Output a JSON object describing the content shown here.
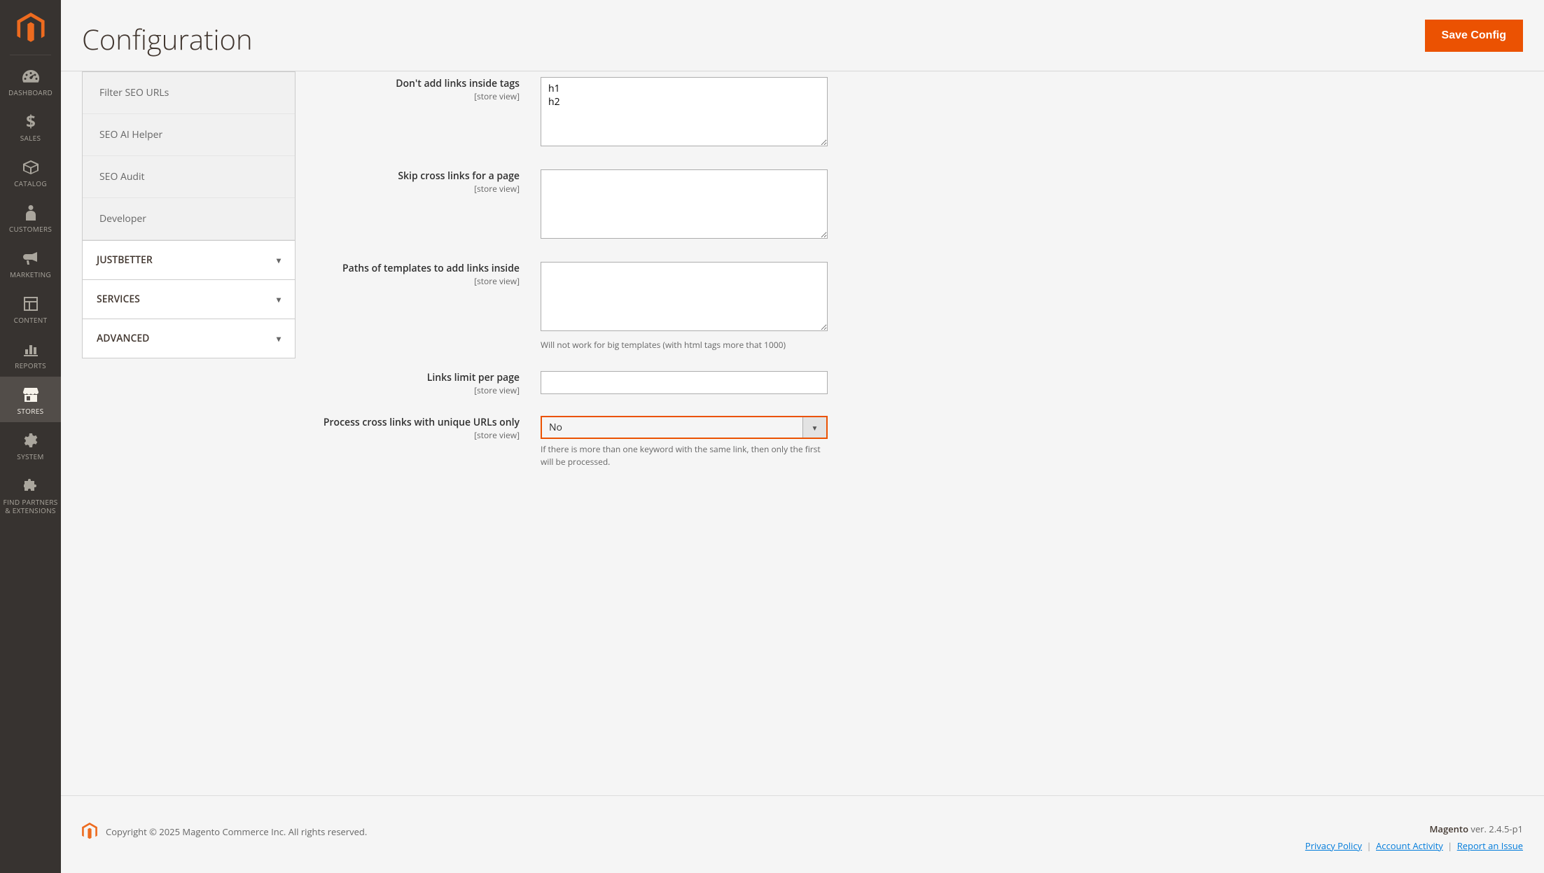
{
  "page": {
    "title": "Configuration"
  },
  "actions": {
    "save": "Save Config"
  },
  "sidebar": {
    "items": [
      {
        "label": "DASHBOARD"
      },
      {
        "label": "SALES"
      },
      {
        "label": "CATALOG"
      },
      {
        "label": "CUSTOMERS"
      },
      {
        "label": "MARKETING"
      },
      {
        "label": "CONTENT"
      },
      {
        "label": "REPORTS"
      },
      {
        "label": "STORES"
      },
      {
        "label": "SYSTEM"
      },
      {
        "label": "FIND PARTNERS & EXTENSIONS"
      }
    ]
  },
  "config_nav": {
    "subitems": [
      "Filter SEO URLs",
      "SEO AI Helper",
      "SEO Audit",
      "Developer"
    ],
    "groups": [
      "JUSTBETTER",
      "SERVICES",
      "ADVANCED"
    ]
  },
  "fields": {
    "scope": "[store view]",
    "no_links_tags": {
      "label": "Don't add links inside tags",
      "value": "h1\nh2"
    },
    "skip_cross": {
      "label": "Skip cross links for a page",
      "value": ""
    },
    "template_paths": {
      "label": "Paths of templates to add links inside",
      "value": "",
      "note": "Will not work for big templates (with html tags more that 1000)"
    },
    "links_limit": {
      "label": "Links limit per page",
      "value": ""
    },
    "unique_urls": {
      "label": "Process cross links with unique URLs only",
      "value": "No",
      "note": "If there is more than one keyword with the same link, then only the first will be processed."
    }
  },
  "footer": {
    "copyright": "Copyright © 2025 Magento Commerce Inc. All rights reserved.",
    "product": "Magento",
    "version": " ver. 2.4.5-p1",
    "links": {
      "privacy": "Privacy Policy",
      "activity": " Account Activity",
      "report": "Report an Issue"
    }
  }
}
